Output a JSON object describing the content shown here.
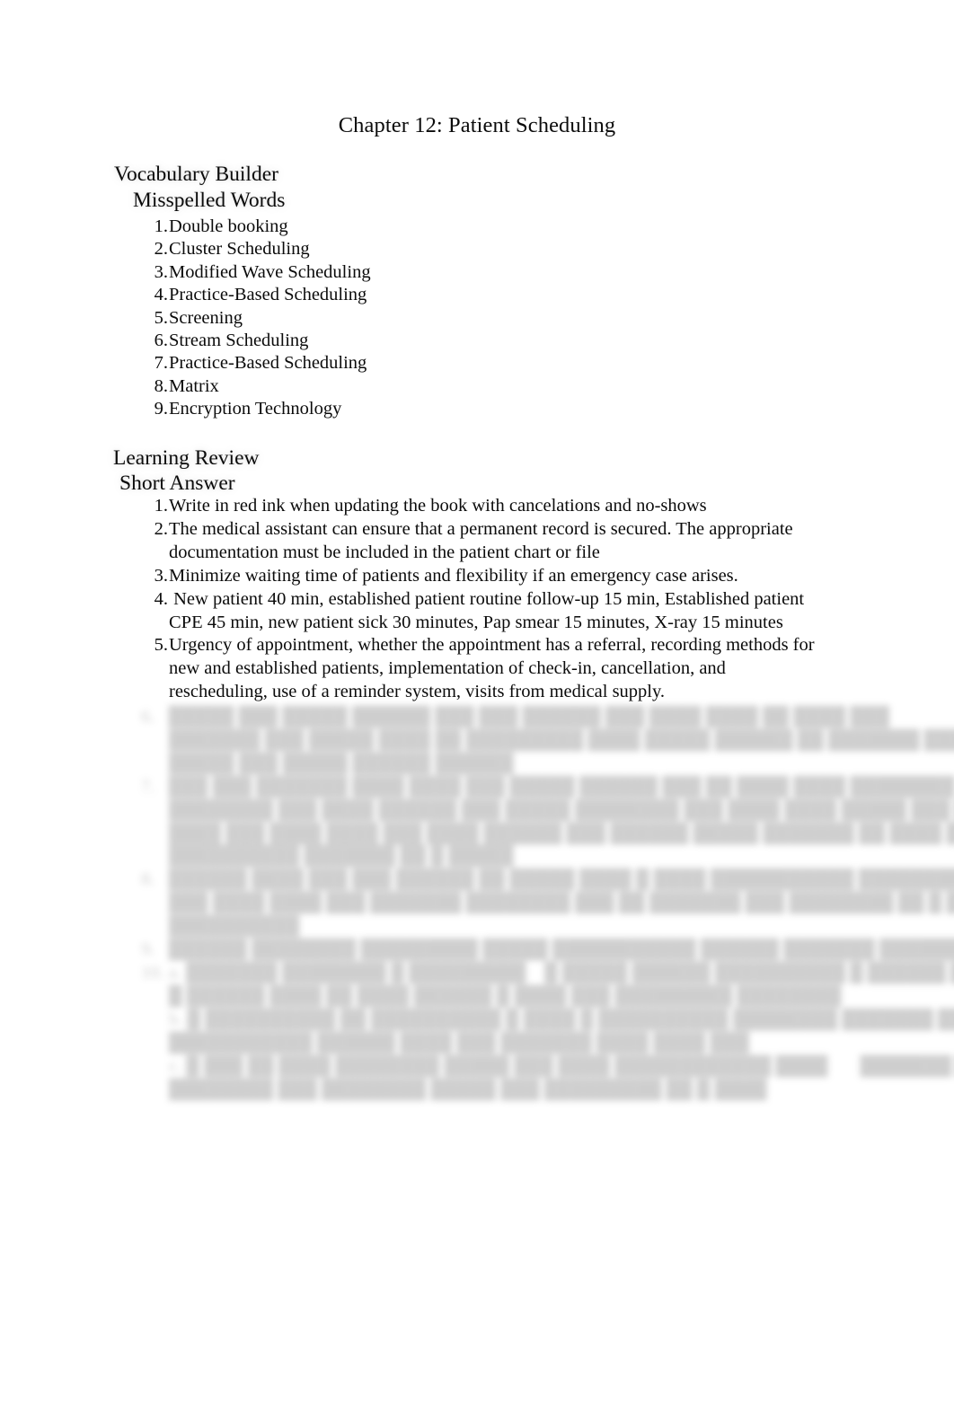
{
  "document": {
    "title": "Chapter 12: Patient Scheduling"
  },
  "vocabulary_builder": {
    "heading": "Vocabulary Builder",
    "subheading": "Misspelled Words",
    "items": [
      {
        "number": "1.",
        "text": "Double booking"
      },
      {
        "number": "2.",
        "text": "Cluster Scheduling"
      },
      {
        "number": "3.",
        "text": "Modified Wave Scheduling"
      },
      {
        "number": "4.",
        "text": "Practice-Based Scheduling"
      },
      {
        "number": "5.",
        "text": "Screening"
      },
      {
        "number": "6.",
        "text": "Stream Scheduling"
      },
      {
        "number": "7.",
        "text": "Practice-Based Scheduling"
      },
      {
        "number": "8.",
        "text": "Matrix"
      },
      {
        "number": "9.",
        "text": "Encryption Technology"
      }
    ]
  },
  "learning_review": {
    "heading": "Learning Review",
    "subheading": "Short Answer",
    "items": [
      {
        "number": "1.",
        "text": "Write in red ink when updating the book with cancelations and no-shows"
      },
      {
        "number": "2.",
        "text": "The medical assistant can ensure that a permanent record is secured. The appropriate documentation must be included in the patient chart or file"
      },
      {
        "number": "3.",
        "text": "Minimize waiting time of patients and flexibility if an emergency case arises."
      },
      {
        "number": "4.",
        "text": " New patient 40 min, established patient routine follow-up 15 min, Established patient CPE 45 min, new patient sick 30 minutes, Pap smear 15 minutes, X-ray 15 minutes"
      },
      {
        "number": "5.",
        "text": "Urgency of appointment, whether the appointment has a referral, recording methods for new and established patients, implementation of check-in, cancellation, and rescheduling, use of a reminder system, visits from medical supply."
      }
    ]
  },
  "obscured_content": {
    "note": "illegible blurred text block",
    "lines": [
      {
        "indent": false,
        "text": "6.   █████ ███ █████ ██████ ███ ███ ██████ ███ ████ ████ ██ ████ ███"
      },
      {
        "indent": true,
        "text": "███████ ███ █████ ████ ██ █████████ ████ █████ ██████ ██ ███████ ████"
      },
      {
        "indent": true,
        "text": "█████ ███ █████ ██████ ██████"
      },
      {
        "indent": false,
        "text": "7.   ███ ███ ███████ ████ ████ ███ █████ ██████ ███ ██ ████ ████ ████████ ███ ████"
      },
      {
        "indent": true,
        "text": "████████ ███ ████ ██████ ███ █████ ████████ ███ ████ ████ █████ ███ █████"
      },
      {
        "indent": true,
        "text": "████ ███ ████ ████ ███ ████ ██████ ███ ██████ █████ ███████ ██ ████ ███████"
      },
      {
        "indent": true,
        "text": "██████████ ███████ ██ █ █████"
      },
      {
        "indent": false,
        "text": "8.   ██████ ████ ███ ███ ██████ ██ █████ ████ █ ████ ███████████ █████████  █████"
      },
      {
        "indent": true,
        "text": "███ ████ ████ ███ ███████ ████████ ███ ██ ███████ ███ ████████ ██ █ ██████████"
      },
      {
        "indent": true,
        "text": "██████████"
      },
      {
        "indent": false,
        "text": "9.   ██████ ████████ █████████ █████ ███████████ ██████ ███████ ████████ ██████"
      },
      {
        "indent": false,
        "text": "10. a. ███████ ████████ █ █████████    █ █████ ██████ ██████████ █ ██████ █████ ███ ███ ████"
      },
      {
        "indent": true,
        "text": "█ ██████ ████ ██ ████ ██████ █ ████ ███ █████████ ████████"
      },
      {
        "indent": true,
        "text": "b. █ ██████████ ██ ██████████ █ ████ █ ██████████ ████████ ███████ ██ ██████ ████"
      },
      {
        "indent": true,
        "text": "███████████ ██████ ████ ███ ███████ ████ ████ ███"
      },
      {
        "indent": true,
        "text": "c. █ ███ ██ ████ ████████ █████ ███ ████ ████████████ ████       ███████ █████████ █████ ██"
      },
      {
        "indent": true,
        "text": "████████ ███ ████████ █████ ███ █████████ ██ █ ████"
      }
    ]
  }
}
